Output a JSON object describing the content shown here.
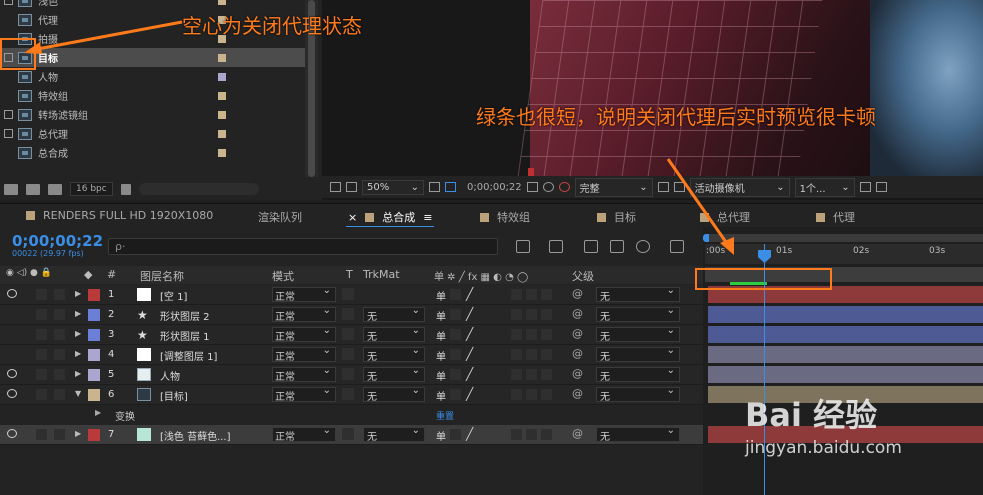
{
  "project": {
    "items": [
      {
        "name": "浅色",
        "checkbox": true,
        "color": "#c9b48e"
      },
      {
        "name": "代理",
        "checkbox": false,
        "color": "#c9b48e"
      },
      {
        "name": "拍摄",
        "checkbox": false,
        "color": "#c9b48e"
      },
      {
        "name": "目标",
        "checkbox": true,
        "color": "#c9b48e",
        "selected": true
      },
      {
        "name": "人物",
        "checkbox": false,
        "color": "#a9a6d0"
      },
      {
        "name": "特效组",
        "checkbox": false,
        "color": "#c9b48e"
      },
      {
        "name": "转场滤镜组",
        "checkbox": true,
        "color": "#c9b48e"
      },
      {
        "name": "总代理",
        "checkbox": true,
        "color": "#c9b48e"
      },
      {
        "name": "总合成",
        "checkbox": false,
        "color": "#c9b48e"
      }
    ],
    "bpc": "16 bpc"
  },
  "viewer": {
    "zoom": "50%",
    "timecode": "0;00;00;22",
    "resolution": "完整",
    "camera": "活动摄像机",
    "views": "1个..."
  },
  "annotations": {
    "proxy_off": "空心为关闭代理状态",
    "green_bar": "绿条也很短，说明关闭代理后实时预览很卡顿"
  },
  "tabs": [
    {
      "label": "RENDERS FULL HD 1920X1080",
      "swatch": true
    },
    {
      "label": "渲染队列",
      "swatch": false
    },
    {
      "label": "总合成",
      "swatch": true,
      "active": true,
      "close": "×",
      "menu": "≡"
    },
    {
      "label": "特效组",
      "swatch": true
    },
    {
      "label": "目标",
      "swatch": true
    },
    {
      "label": "总代理",
      "swatch": true
    },
    {
      "label": "代理",
      "swatch": true
    }
  ],
  "timeline": {
    "timecode": "0;00;00;22",
    "fps": "00022 (29.97 fps)",
    "search_placeholder": "ρ·",
    "headers": {
      "layer_name": "图层名称",
      "mode": "模式",
      "t": "T",
      "trkmat": "TrkMat",
      "parent": "父级",
      "num": "#"
    },
    "layers": [
      {
        "num": "1",
        "name": "[空 1]",
        "mode": "正常",
        "trk": "",
        "parent": "无",
        "label": "#b83a3a",
        "icon": "solid-white",
        "eye": true,
        "bar": "#8e3a3a"
      },
      {
        "num": "2",
        "name": "形状图层 2",
        "mode": "正常",
        "trk": "无",
        "parent": "无",
        "label": "#6b7fd6",
        "icon": "star",
        "eye": false,
        "bar": "#4e5a93"
      },
      {
        "num": "3",
        "name": "形状图层 1",
        "mode": "正常",
        "trk": "无",
        "parent": "无",
        "label": "#6b7fd6",
        "icon": "star",
        "eye": false,
        "bar": "#4e5a93"
      },
      {
        "num": "4",
        "name": "[调整图层 1]",
        "mode": "正常",
        "trk": "无",
        "parent": "无",
        "label": "#a9a6d0",
        "icon": "solid-white",
        "eye": false,
        "bar": "#6b6a83"
      },
      {
        "num": "5",
        "name": "人物",
        "mode": "正常",
        "trk": "无",
        "parent": "无",
        "label": "#a9a6d0",
        "icon": "footage",
        "eye": true,
        "bar": "#6b6a83"
      },
      {
        "num": "6",
        "name": "[目标]",
        "mode": "正常",
        "trk": "无",
        "parent": "无",
        "label": "#c9b48e",
        "icon": "comp",
        "eye": true,
        "bar": "#7e735d"
      },
      {
        "num": "7",
        "name": "[浅色 苔藓色...]",
        "mode": "正常",
        "trk": "无",
        "parent": "无",
        "label": "#b83a3a",
        "icon": "solid-mint",
        "eye": true,
        "bar": "#8e3a3a"
      }
    ],
    "transform_label": "变换",
    "reset_label": "重置"
  },
  "time_ruler": {
    "ticks": [
      ":00s",
      "01s",
      "02s",
      "03s"
    ]
  },
  "watermark": {
    "brand": "Bai 经验",
    "url": "jingyan.baidu.com"
  },
  "colors": {
    "accent": "#3a8ee6",
    "annotation": "#ff7a1a",
    "progress": "#2ecc40"
  }
}
